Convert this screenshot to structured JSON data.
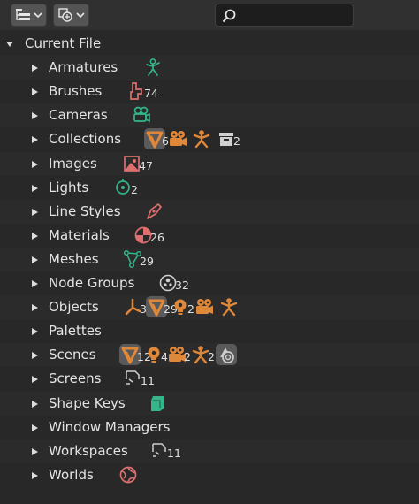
{
  "header": {
    "display_mode_icon": "outliner-list-icon",
    "filter_icon": "filter-icon",
    "dropdown_icon": "chevron-down-icon",
    "search_icon": "search-icon",
    "search_value": ""
  },
  "colors": {
    "object_orange": "#e0883a",
    "data_green": "#34b58a",
    "image_red": "#dd6f6f",
    "accent_grey": "#cfcfcf"
  },
  "tree": {
    "root_label": "Current File",
    "items": [
      {
        "label": "Armatures",
        "icons": [
          {
            "name": "armature-icon",
            "count": ""
          }
        ]
      },
      {
        "label": "Brushes",
        "icons": [
          {
            "name": "brush-icon",
            "count": "74"
          }
        ]
      },
      {
        "label": "Cameras",
        "icons": [
          {
            "name": "camera-data-icon",
            "count": ""
          }
        ]
      },
      {
        "label": "Collections",
        "icons": [
          {
            "name": "mesh-icon",
            "count": "6",
            "hl": true
          },
          {
            "name": "camera-object-icon",
            "count": ""
          },
          {
            "name": "armature-object-icon",
            "count": ""
          },
          {
            "name": "collection-box-icon",
            "count": "2"
          }
        ]
      },
      {
        "label": "Images",
        "icons": [
          {
            "name": "image-icon",
            "count": "47"
          }
        ]
      },
      {
        "label": "Lights",
        "icons": [
          {
            "name": "light-data-icon",
            "count": "2"
          }
        ]
      },
      {
        "label": "Line Styles",
        "icons": [
          {
            "name": "linestyle-icon",
            "count": ""
          }
        ]
      },
      {
        "label": "Materials",
        "icons": [
          {
            "name": "material-icon",
            "count": "26"
          }
        ]
      },
      {
        "label": "Meshes",
        "icons": [
          {
            "name": "mesh-data-icon",
            "count": "29"
          }
        ]
      },
      {
        "label": "Node Groups",
        "icons": [
          {
            "name": "node-group-icon",
            "count": "32"
          }
        ]
      },
      {
        "label": "Objects",
        "icons": [
          {
            "name": "empty-axes-icon",
            "count": "3"
          },
          {
            "name": "mesh-icon",
            "count": "29",
            "hl": true
          },
          {
            "name": "light-object-icon",
            "count": "2"
          },
          {
            "name": "camera-object-icon",
            "count": ""
          },
          {
            "name": "armature-object-icon",
            "count": ""
          }
        ]
      },
      {
        "label": "Palettes",
        "icons": []
      },
      {
        "label": "Scenes",
        "icons": [
          {
            "name": "mesh-icon",
            "count": "12",
            "hl": true
          },
          {
            "name": "light-object-icon",
            "count": "4"
          },
          {
            "name": "camera-object-icon",
            "count": "2"
          },
          {
            "name": "armature-object-icon",
            "count": "2"
          },
          {
            "name": "scene-icon",
            "count": "",
            "hl": true
          }
        ]
      },
      {
        "label": "Screens",
        "icons": [
          {
            "name": "screen-icon",
            "count": "11"
          }
        ]
      },
      {
        "label": "Shape Keys",
        "icons": [
          {
            "name": "shape-key-icon",
            "count": ""
          }
        ]
      },
      {
        "label": "Window Managers",
        "icons": []
      },
      {
        "label": "Workspaces",
        "icons": [
          {
            "name": "workspace-icon",
            "count": "11"
          }
        ]
      },
      {
        "label": "Worlds",
        "icons": [
          {
            "name": "world-icon",
            "count": ""
          }
        ]
      }
    ]
  }
}
